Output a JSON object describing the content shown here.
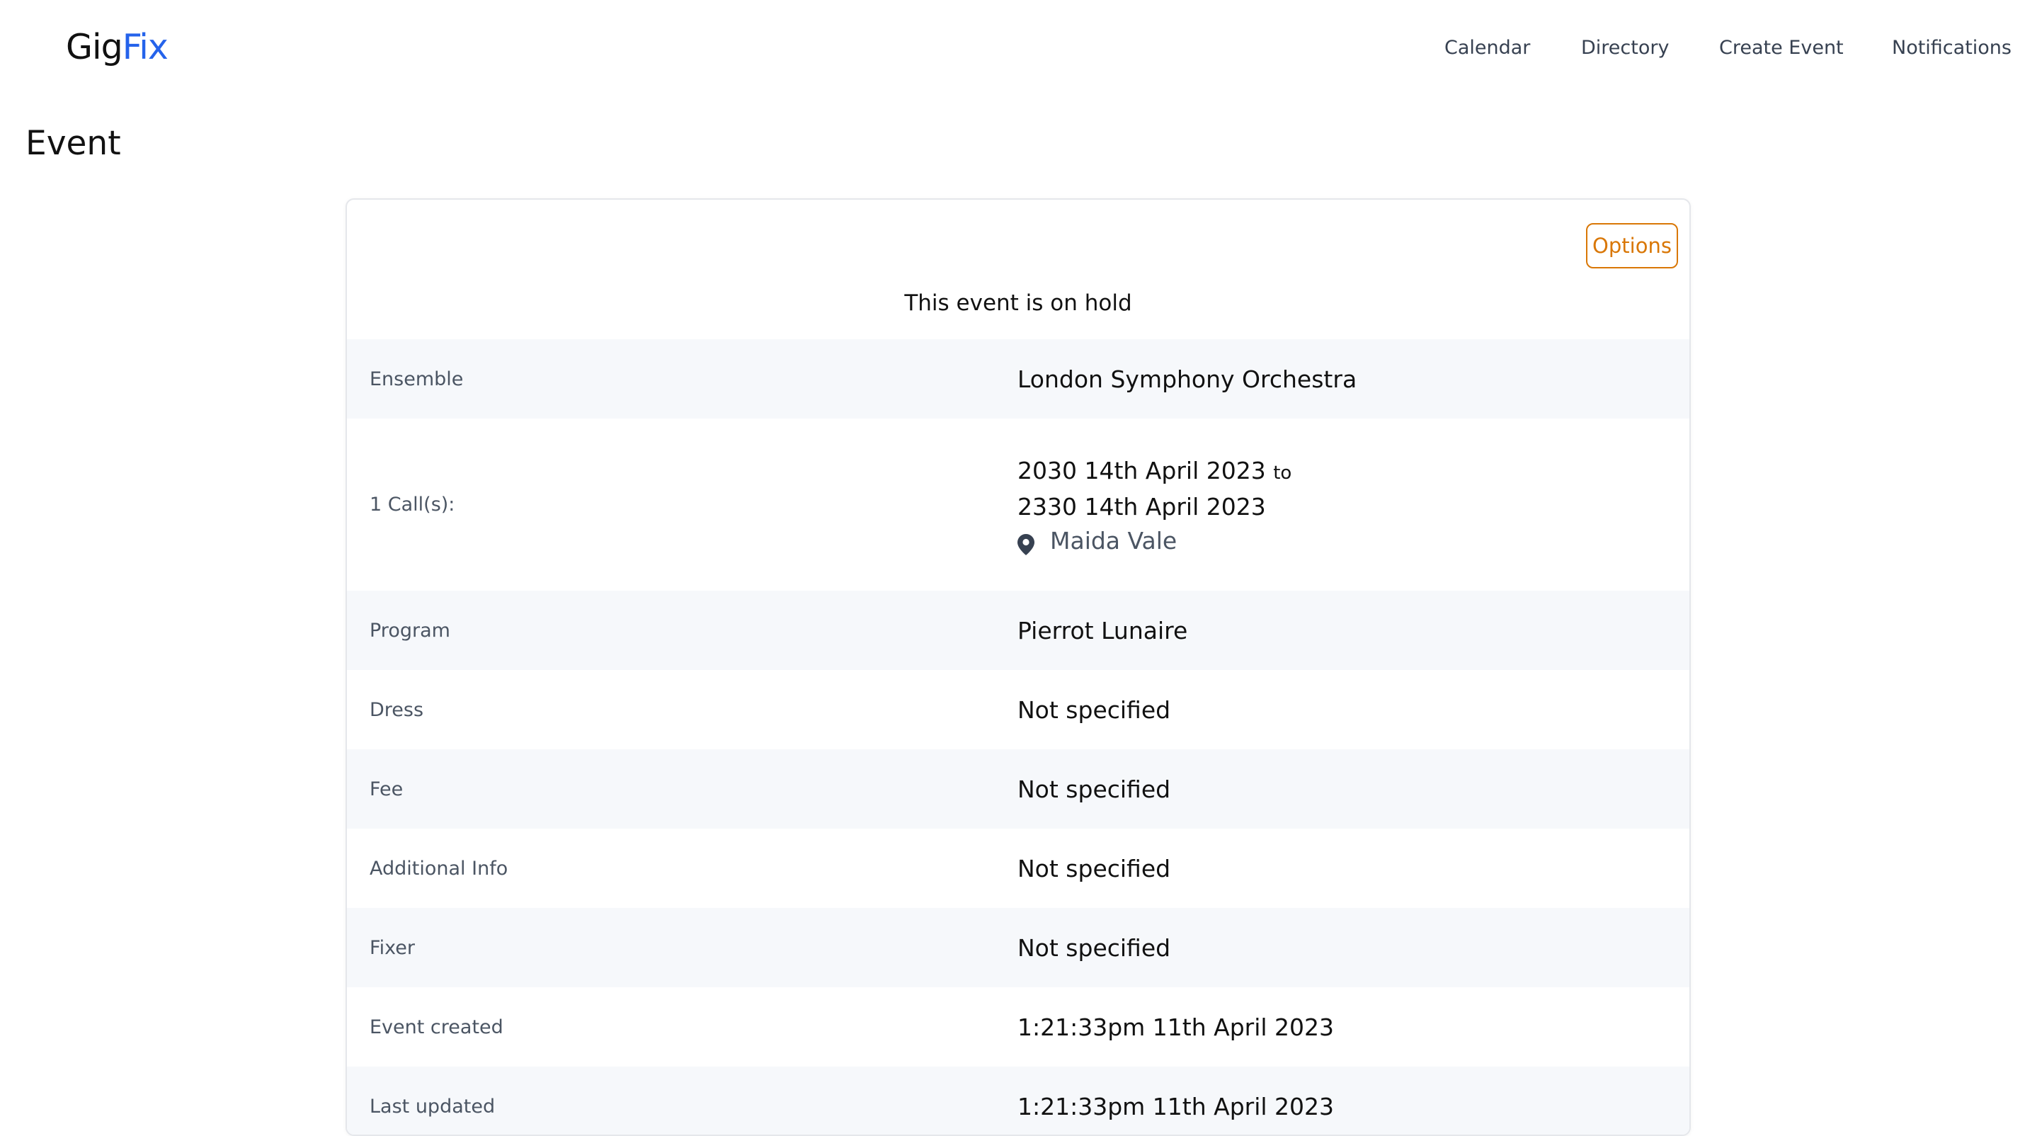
{
  "app": {
    "logo_part1": "Gig",
    "logo_part2": "Fix",
    "accent_color": "#2563eb"
  },
  "nav": {
    "items": [
      {
        "label": "Calendar"
      },
      {
        "label": "Directory"
      },
      {
        "label": "Create Event"
      },
      {
        "label": "Notifications"
      }
    ]
  },
  "page": {
    "title": "Event"
  },
  "event": {
    "options_label": "Options",
    "status": "This event is on hold",
    "ensemble": {
      "label": "Ensemble",
      "value": "London Symphony Orchestra"
    },
    "calls": {
      "label": "1 Call(s):",
      "start": "2030 14th April 2023",
      "to_word": "to",
      "end": "2330 14th April 2023",
      "location": "Maida Vale",
      "location_icon": "map-pin-icon"
    },
    "program": {
      "label": "Program",
      "value": "Pierrot Lunaire"
    },
    "dress": {
      "label": "Dress",
      "value": "Not specified"
    },
    "fee": {
      "label": "Fee",
      "value": "Not specified"
    },
    "additional_info": {
      "label": "Additional Info",
      "value": "Not specified"
    },
    "fixer": {
      "label": "Fixer",
      "value": "Not specified"
    },
    "created": {
      "label": "Event created",
      "value": "1:21:33pm 11th April 2023"
    },
    "updated": {
      "label": "Last updated",
      "value": "1:21:33pm 11th April 2023"
    }
  },
  "colors": {
    "options_accent": "#d97706",
    "row_shade": "#f6f8fb"
  }
}
